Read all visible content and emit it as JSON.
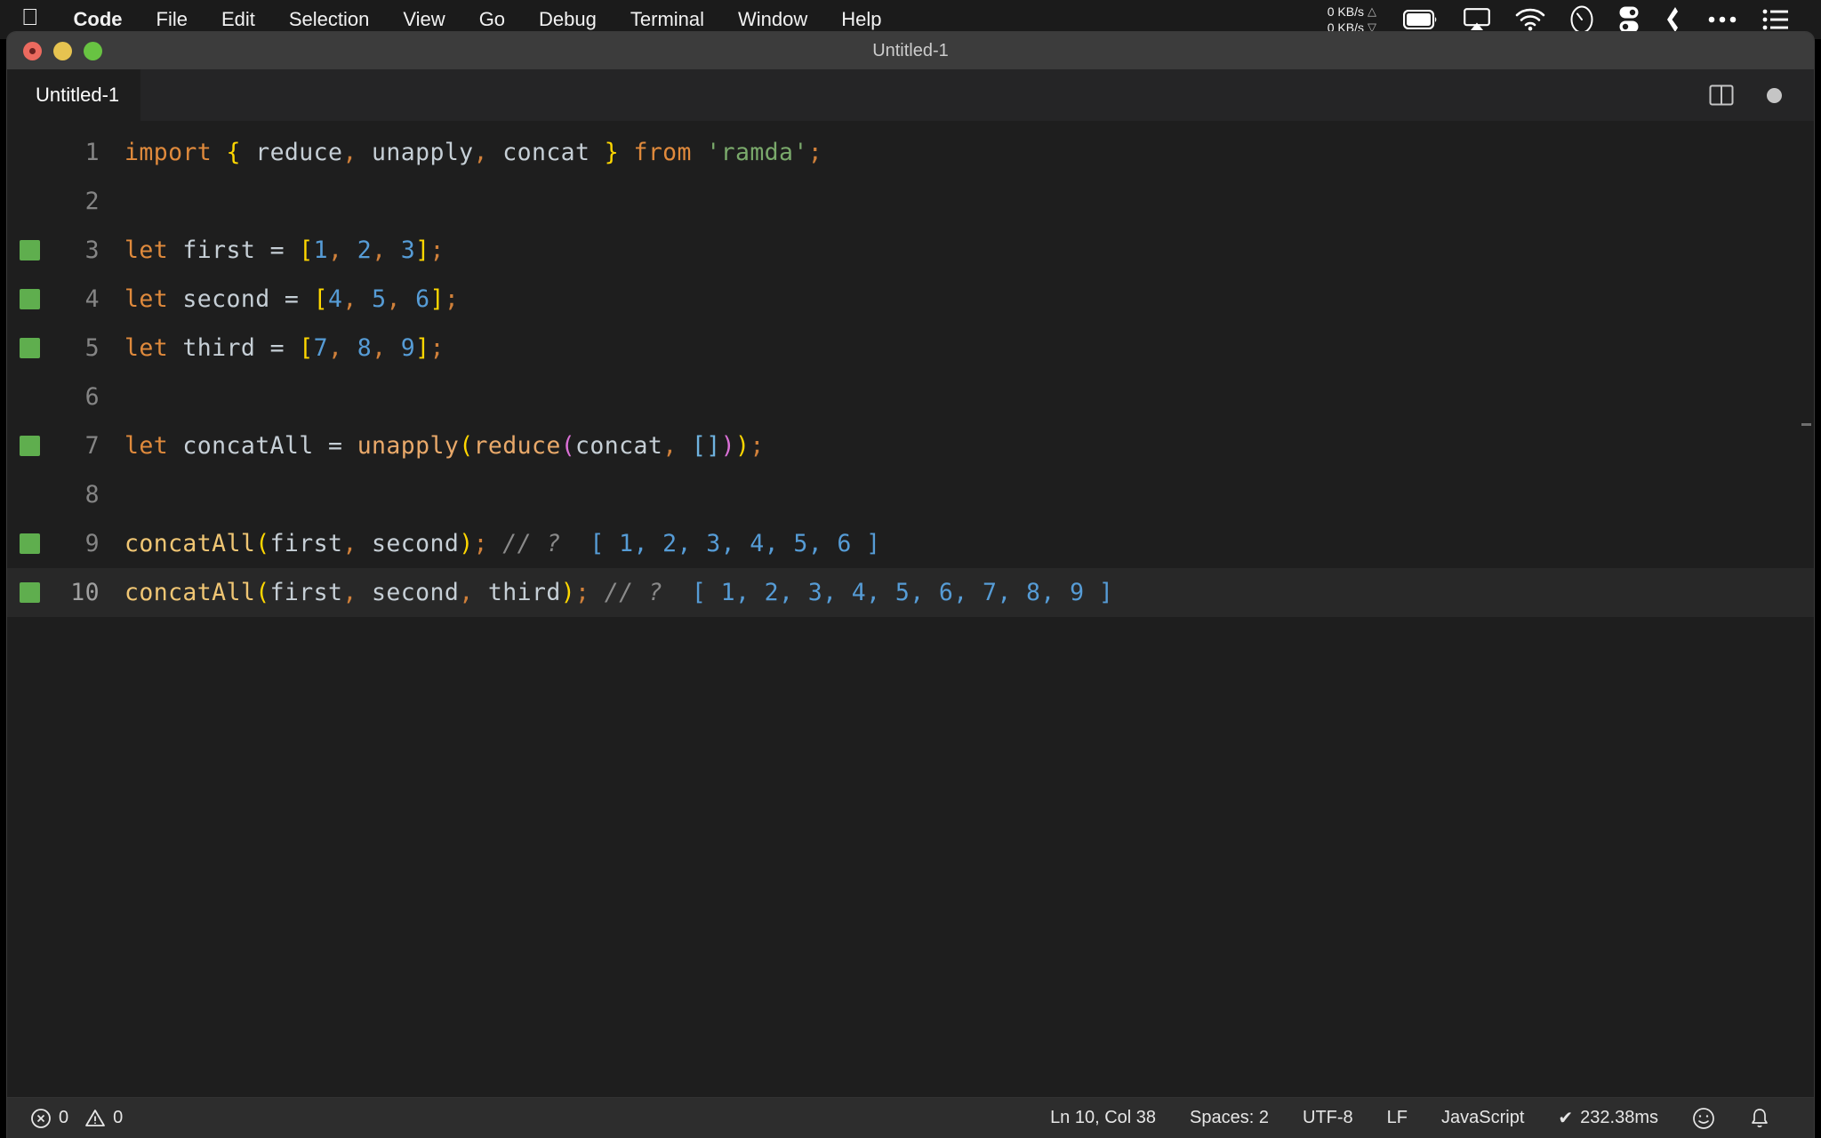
{
  "menubar": {
    "apple_glyph": "",
    "items": [
      {
        "label": "Code",
        "bold": true
      },
      {
        "label": "File",
        "bold": false
      },
      {
        "label": "Edit",
        "bold": false
      },
      {
        "label": "Selection",
        "bold": false
      },
      {
        "label": "View",
        "bold": false
      },
      {
        "label": "Go",
        "bold": false
      },
      {
        "label": "Debug",
        "bold": false
      },
      {
        "label": "Terminal",
        "bold": false
      },
      {
        "label": "Window",
        "bold": false
      },
      {
        "label": "Help",
        "bold": false
      }
    ],
    "net_up": "0 KB/s",
    "net_down": "0 KB/s",
    "net_up_arrow": "△",
    "net_down_arrow": "▽",
    "status_icons": [
      "battery-icon",
      "airplay-icon",
      "wifi-icon",
      "clock-icon",
      "switch-icon",
      "dropbox-icon",
      "ellipsis-icon",
      "control-center-icon"
    ]
  },
  "window": {
    "title": "Untitled-1",
    "traffic_lights": [
      "close",
      "minimize",
      "maximize"
    ]
  },
  "tabs": {
    "items": [
      {
        "label": "Untitled-1",
        "active": true,
        "dirty": true
      }
    ],
    "split_editor_label": "split-editor",
    "dirty_indicator_label": "unsaved-changes"
  },
  "editor": {
    "language": "JavaScript",
    "lines": [
      {
        "number": "1",
        "marker": false,
        "active": false,
        "tokens": [
          {
            "t": "import",
            "c": "t-kw"
          },
          {
            "t": " ",
            "c": "t-var"
          },
          {
            "t": "{",
            "c": "t-brc-y"
          },
          {
            "t": " reduce",
            "c": "t-var"
          },
          {
            "t": ",",
            "c": "t-punc"
          },
          {
            "t": " unapply",
            "c": "t-var"
          },
          {
            "t": ",",
            "c": "t-punc"
          },
          {
            "t": " concat ",
            "c": "t-var"
          },
          {
            "t": "}",
            "c": "t-brc-y"
          },
          {
            "t": " ",
            "c": "t-var"
          },
          {
            "t": "from",
            "c": "t-kw"
          },
          {
            "t": " ",
            "c": "t-var"
          },
          {
            "t": "'ramda'",
            "c": "t-str"
          },
          {
            "t": ";",
            "c": "t-punc"
          }
        ]
      },
      {
        "number": "2",
        "marker": false,
        "active": false,
        "tokens": []
      },
      {
        "number": "3",
        "marker": true,
        "active": false,
        "tokens": [
          {
            "t": "let",
            "c": "t-kw"
          },
          {
            "t": " first ",
            "c": "t-var"
          },
          {
            "t": "=",
            "c": "t-op"
          },
          {
            "t": " ",
            "c": "t-var"
          },
          {
            "t": "[",
            "c": "t-brc-y"
          },
          {
            "t": "1",
            "c": "t-num"
          },
          {
            "t": ",",
            "c": "t-punc"
          },
          {
            "t": " ",
            "c": "t-var"
          },
          {
            "t": "2",
            "c": "t-num"
          },
          {
            "t": ",",
            "c": "t-punc"
          },
          {
            "t": " ",
            "c": "t-var"
          },
          {
            "t": "3",
            "c": "t-num"
          },
          {
            "t": "]",
            "c": "t-brc-y"
          },
          {
            "t": ";",
            "c": "t-punc"
          }
        ]
      },
      {
        "number": "4",
        "marker": true,
        "active": false,
        "tokens": [
          {
            "t": "let",
            "c": "t-kw"
          },
          {
            "t": " second ",
            "c": "t-var"
          },
          {
            "t": "=",
            "c": "t-op"
          },
          {
            "t": " ",
            "c": "t-var"
          },
          {
            "t": "[",
            "c": "t-brc-y"
          },
          {
            "t": "4",
            "c": "t-num"
          },
          {
            "t": ",",
            "c": "t-punc"
          },
          {
            "t": " ",
            "c": "t-var"
          },
          {
            "t": "5",
            "c": "t-num"
          },
          {
            "t": ",",
            "c": "t-punc"
          },
          {
            "t": " ",
            "c": "t-var"
          },
          {
            "t": "6",
            "c": "t-num"
          },
          {
            "t": "]",
            "c": "t-brc-y"
          },
          {
            "t": ";",
            "c": "t-punc"
          }
        ]
      },
      {
        "number": "5",
        "marker": true,
        "active": false,
        "tokens": [
          {
            "t": "let",
            "c": "t-kw"
          },
          {
            "t": " third ",
            "c": "t-var"
          },
          {
            "t": "=",
            "c": "t-op"
          },
          {
            "t": " ",
            "c": "t-var"
          },
          {
            "t": "[",
            "c": "t-brc-y"
          },
          {
            "t": "7",
            "c": "t-num"
          },
          {
            "t": ",",
            "c": "t-punc"
          },
          {
            "t": " ",
            "c": "t-var"
          },
          {
            "t": "8",
            "c": "t-num"
          },
          {
            "t": ",",
            "c": "t-punc"
          },
          {
            "t": " ",
            "c": "t-var"
          },
          {
            "t": "9",
            "c": "t-num"
          },
          {
            "t": "]",
            "c": "t-brc-y"
          },
          {
            "t": ";",
            "c": "t-punc"
          }
        ]
      },
      {
        "number": "6",
        "marker": false,
        "active": false,
        "tokens": []
      },
      {
        "number": "7",
        "marker": true,
        "active": false,
        "tokens": [
          {
            "t": "let",
            "c": "t-kw"
          },
          {
            "t": " concatAll ",
            "c": "t-var"
          },
          {
            "t": "=",
            "c": "t-op"
          },
          {
            "t": " ",
            "c": "t-var"
          },
          {
            "t": "unapply",
            "c": "t-fn"
          },
          {
            "t": "(",
            "c": "t-brc-y"
          },
          {
            "t": "reduce",
            "c": "t-fn"
          },
          {
            "t": "(",
            "c": "t-brc-m"
          },
          {
            "t": "concat",
            "c": "t-var"
          },
          {
            "t": ",",
            "c": "t-punc"
          },
          {
            "t": " ",
            "c": "t-var"
          },
          {
            "t": "[]",
            "c": "t-brc-b"
          },
          {
            "t": ")",
            "c": "t-brc-m"
          },
          {
            "t": ")",
            "c": "t-brc-y"
          },
          {
            "t": ";",
            "c": "t-punc"
          }
        ]
      },
      {
        "number": "8",
        "marker": false,
        "active": false,
        "tokens": []
      },
      {
        "number": "9",
        "marker": true,
        "active": false,
        "tokens": [
          {
            "t": "concatAll",
            "c": "t-fn2"
          },
          {
            "t": "(",
            "c": "t-brc-y"
          },
          {
            "t": "first",
            "c": "t-var"
          },
          {
            "t": ",",
            "c": "t-punc"
          },
          {
            "t": " second",
            "c": "t-var"
          },
          {
            "t": ")",
            "c": "t-brc-y"
          },
          {
            "t": ";",
            "c": "t-punc"
          },
          {
            "t": " // ?",
            "c": "t-cmt"
          },
          {
            "t": "  [ 1, 2, 3, 4, 5, 6 ]",
            "c": "t-res"
          }
        ]
      },
      {
        "number": "10",
        "marker": true,
        "active": true,
        "tokens": [
          {
            "t": "concatAll",
            "c": "t-fn2"
          },
          {
            "t": "(",
            "c": "t-brc-y"
          },
          {
            "t": "first",
            "c": "t-var"
          },
          {
            "t": ",",
            "c": "t-punc"
          },
          {
            "t": " second",
            "c": "t-var"
          },
          {
            "t": ",",
            "c": "t-punc"
          },
          {
            "t": " third",
            "c": "t-var"
          },
          {
            "t": ")",
            "c": "t-brc-y"
          },
          {
            "t": ";",
            "c": "t-punc"
          },
          {
            "t": " // ?",
            "c": "t-cmt"
          },
          {
            "t": "  [ 1, 2, 3, 4, 5, 6, 7, 8, 9 ]",
            "c": "t-res"
          }
        ]
      }
    ]
  },
  "statusbar": {
    "errors": "0",
    "warnings": "0",
    "cursor": "Ln 10, Col 38",
    "indent": "Spaces: 2",
    "encoding": "UTF-8",
    "eol": "LF",
    "language": "JavaScript",
    "timing": "232.38ms",
    "timing_check": "✔",
    "feedback_icon": "smiley-icon",
    "bell_icon": "bell-icon"
  },
  "colors": {
    "menubar_bg": "#1b1b1b",
    "titlebar_bg": "#3c3c3c",
    "editor_bg": "#1e1e1e",
    "tabbar_bg": "#252526",
    "statusbar_bg": "#2d2d2d",
    "gutter_marker": "#5fae4e",
    "keyword": "#e08a3c",
    "string": "#7aa96b",
    "number": "#569cd6",
    "bracket_yellow": "#ffd700",
    "bracket_magenta": "#da70d6",
    "bracket_blue": "#6fb3e0",
    "comment": "#8a8a8a"
  }
}
